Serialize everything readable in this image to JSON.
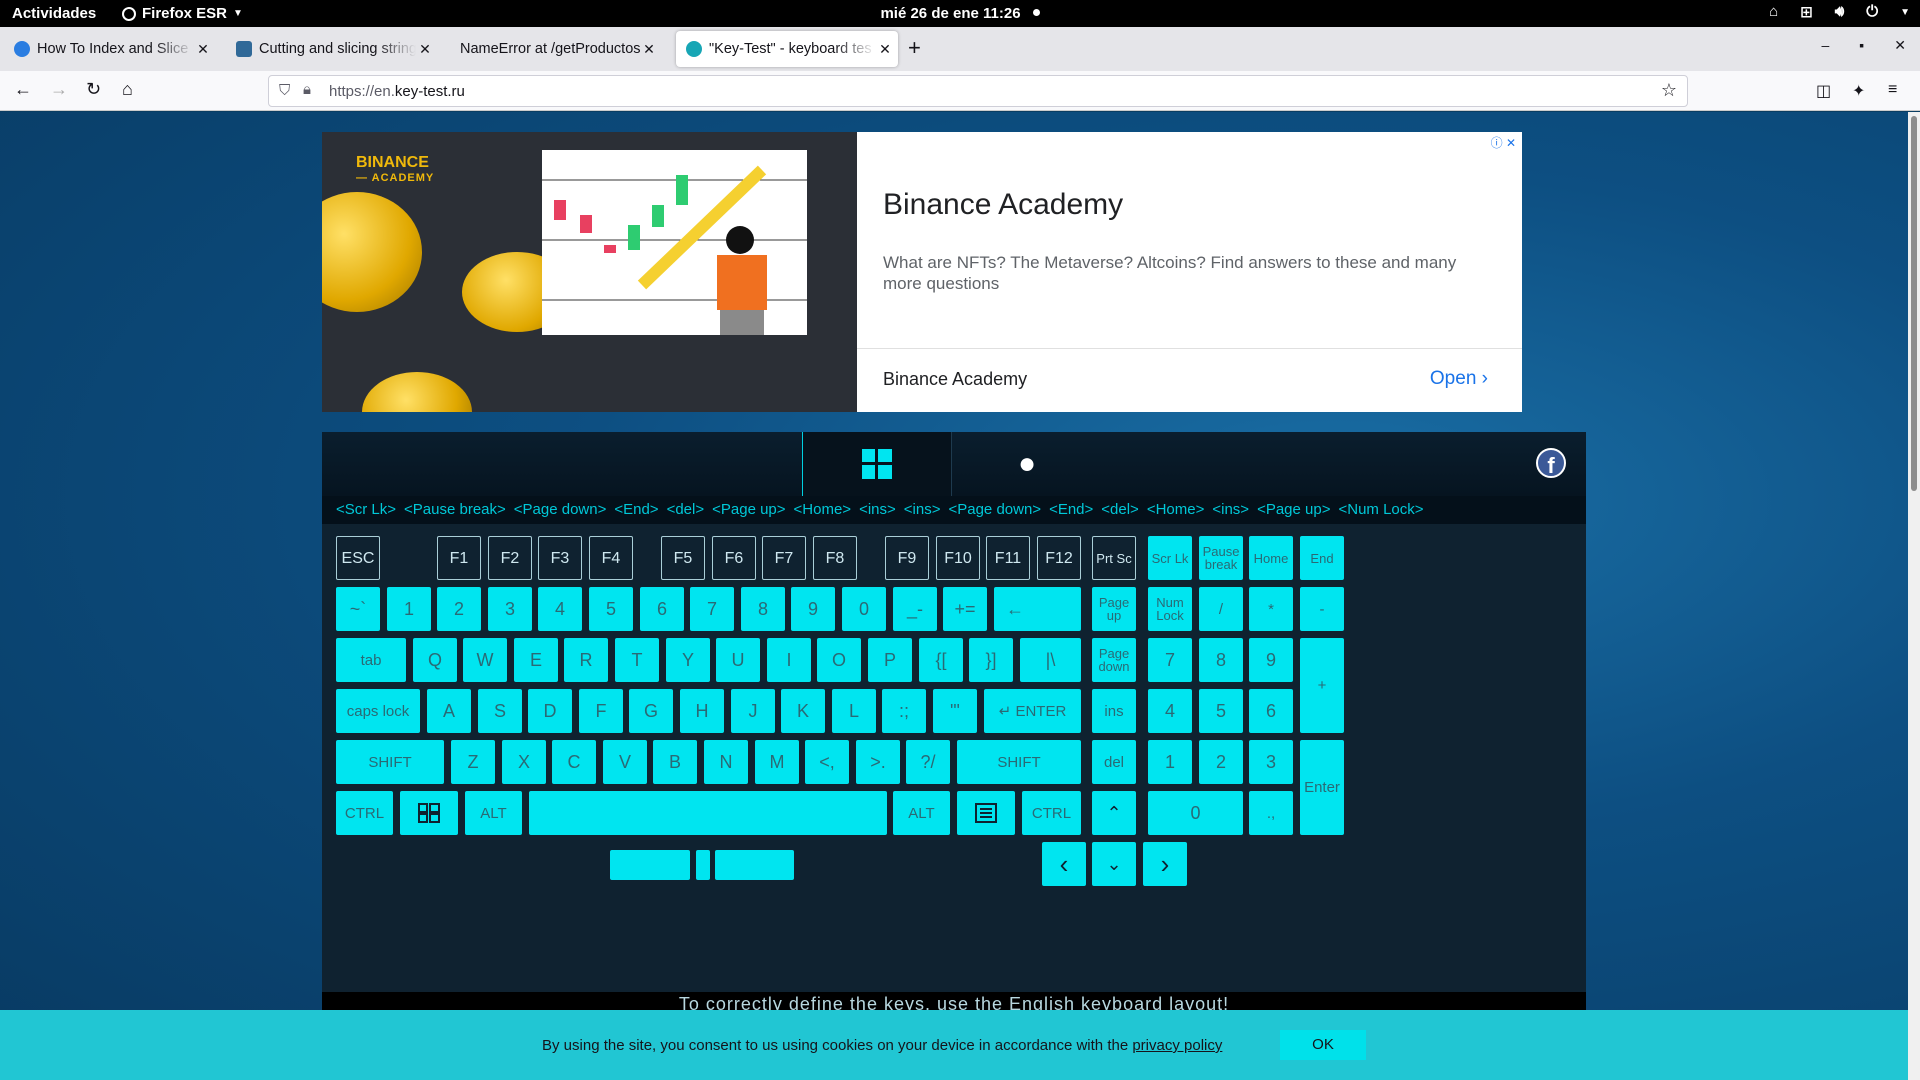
{
  "topbar": {
    "activities": "Actividades",
    "app": "Firefox ESR",
    "clock": "mié 26 de ene  11:26"
  },
  "tabs": [
    {
      "title": "How To Index and Slice St",
      "fav_color": "#2a7de1"
    },
    {
      "title": "Cutting and slicing string",
      "fav_color": "#306998"
    },
    {
      "title": "NameError at /getProductos/",
      "fav_color": "#e5e5e9"
    },
    {
      "title": "\"Key-Test\" - keyboard tes",
      "fav_color": "#17a6b5"
    }
  ],
  "navbar": {
    "url_prefix": "https://en.",
    "url_domain": "key-test.ru"
  },
  "ad": {
    "logo": "BINANCE",
    "logo_sub": "— ACADEMY",
    "title": "Binance Academy",
    "description": "What are NFTs? The Metaverse? Altcoins? Find answers to these and many more questions",
    "advertiser": "Binance Academy",
    "cta": "Open"
  },
  "history": [
    "<Scr Lk>",
    "<Pause break>",
    "<Page down>",
    "<End>",
    "<del>",
    "<Page up>",
    "<Home>",
    "<ins>",
    "<ins>",
    "<Page down>",
    "<End>",
    "<del>",
    "<Home>",
    "<ins>",
    "<Page up>",
    "<Num Lock>"
  ],
  "keyboard": {
    "esc": "ESC",
    "f": [
      "F1",
      "F2",
      "F3",
      "F4",
      "F5",
      "F6",
      "F7",
      "F8",
      "F9",
      "F10",
      "F11",
      "F12"
    ],
    "prtsc": "Prt Sc",
    "scrlk": "Scr Lk",
    "pause": "Pause break",
    "home": "Home",
    "end": "End",
    "row1": [
      "~ `",
      "1",
      "2",
      "3",
      "4",
      "5",
      "6",
      "7",
      "8",
      "9",
      "0",
      "_ -",
      "+ ="
    ],
    "backspace": "←",
    "pageup": "Page up",
    "numlock": "Num Lock",
    "num_slash": "/",
    "num_star": "*",
    "num_minus": "-",
    "tab": "tab",
    "row2": [
      "Q",
      "W",
      "E",
      "R",
      "T",
      "Y",
      "U",
      "I",
      "O",
      "P",
      "{ [",
      "} ]",
      "| \\"
    ],
    "pagedown": "Page down",
    "num7": "7",
    "num8": "8",
    "num9": "9",
    "num_plus": "+",
    "capslock": "caps lock",
    "row3": [
      "A",
      "S",
      "D",
      "F",
      "G",
      "H",
      "J",
      "K",
      "L",
      ": ;",
      "\" '"
    ],
    "enter": "↵ ENTER",
    "ins": "ins",
    "num4": "4",
    "num5": "5",
    "num6": "6",
    "shift_l": "SHIFT",
    "row4": [
      "Z",
      "X",
      "C",
      "V",
      "B",
      "N",
      "M",
      "< ,",
      "> .",
      "? /"
    ],
    "shift_r": "SHIFT",
    "del": "del",
    "num1": "1",
    "num2": "2",
    "num3": "3",
    "num_enter": "Enter",
    "ctrl_l": "CTRL",
    "alt_l": "ALT",
    "alt_r": "ALT",
    "ctrl_r": "CTRL",
    "num0": "0",
    "num_dot": ". ,",
    "arrow_up": "⌃",
    "arrow_left": "‹",
    "arrow_down": "⌄",
    "arrow_right": "›"
  },
  "notice": "To correctly define the keys, use the English keyboard layout!",
  "cookie": {
    "message": "By using the site, you consent to us using cookies on your device in accordance with the",
    "link": "privacy policy",
    "ok": "OK"
  },
  "colors": {
    "key": "#00e5f0",
    "page_bg": "#0d4f82",
    "cookie_bar": "#21c6d3"
  }
}
